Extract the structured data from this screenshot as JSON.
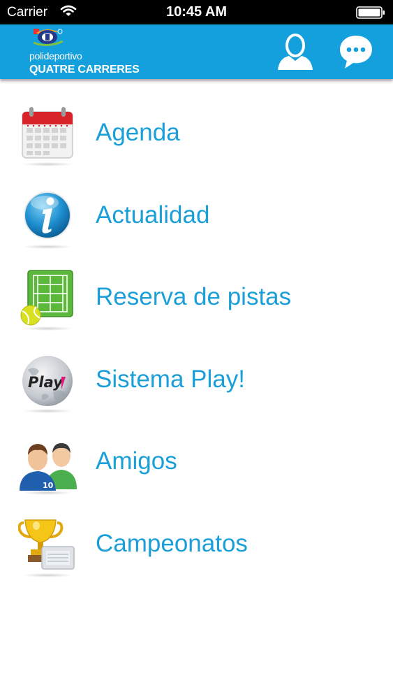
{
  "status_bar": {
    "carrier": "Carrier",
    "time": "10:45 AM"
  },
  "header": {
    "logo_small": "polideportivo",
    "logo_big": "QUATRE CARRERES",
    "background_color": "#14a0dc"
  },
  "menu": {
    "text_color": "#1a9fd8",
    "items": [
      {
        "label": "Agenda",
        "icon": "calendar-icon"
      },
      {
        "label": "Actualidad",
        "icon": "info-icon"
      },
      {
        "label": "Reserva de pistas",
        "icon": "tennis-court-icon"
      },
      {
        "label": "Sistema Play!",
        "icon": "play-globe-icon"
      },
      {
        "label": "Amigos",
        "icon": "friends-icon"
      },
      {
        "label": "Campeonatos",
        "icon": "trophy-icon"
      }
    ]
  }
}
